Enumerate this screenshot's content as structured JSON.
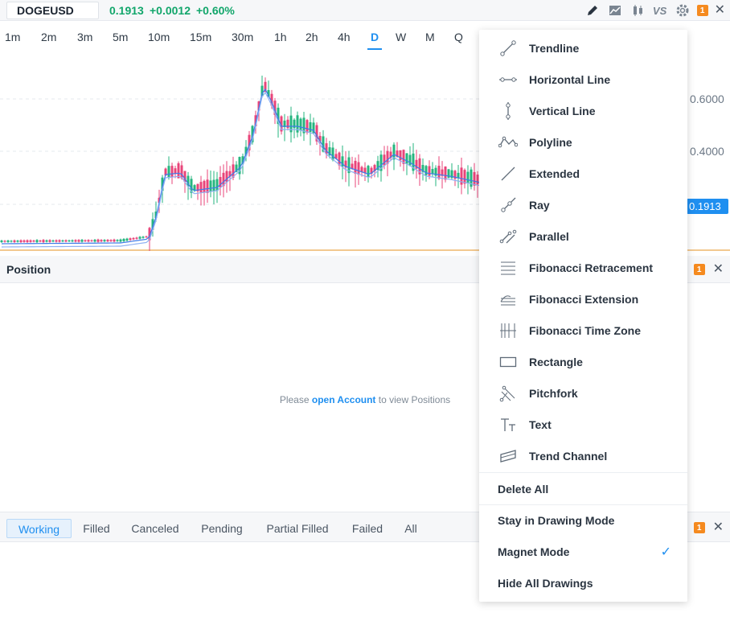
{
  "topbar": {
    "symbol": "DOGEUSD",
    "last": "0.1913",
    "change": "+0.0012",
    "change_pct": "+0.60%",
    "badge": "1"
  },
  "timeframes": [
    "1m",
    "2m",
    "3m",
    "5m",
    "10m",
    "15m",
    "30m",
    "1h",
    "2h",
    "4h",
    "D",
    "W",
    "M",
    "Q"
  ],
  "active_timeframe": "D",
  "chart": {
    "price_labels": [
      "0.6000",
      "0.4000"
    ],
    "last_price": "0.1913",
    "colors": {
      "up": "#26b57f",
      "down": "#e8447a",
      "ma": "#3d7be8",
      "last": "#1f8ff0"
    }
  },
  "position_panel": {
    "title": "Position",
    "badge": "1",
    "msg_pre": "Please",
    "msg_link": "open Account",
    "msg_post": "to view Positions"
  },
  "orders_panel": {
    "tabs": [
      "Working",
      "Filled",
      "Canceled",
      "Pending",
      "Partial Filled",
      "Failed",
      "All"
    ],
    "active_tab": "Working",
    "badge": "1"
  },
  "drawing_menu": {
    "tools": [
      {
        "label": "Trendline",
        "icon": "trendline-icon"
      },
      {
        "label": "Horizontal Line",
        "icon": "horizontal-line-icon"
      },
      {
        "label": "Vertical Line",
        "icon": "vertical-line-icon"
      },
      {
        "label": "Polyline",
        "icon": "polyline-icon"
      },
      {
        "label": "Extended",
        "icon": "extended-line-icon"
      },
      {
        "label": "Ray",
        "icon": "ray-icon"
      },
      {
        "label": "Parallel",
        "icon": "parallel-icon"
      },
      {
        "label": "Fibonacci Retracement",
        "icon": "fib-retracement-icon"
      },
      {
        "label": "Fibonacci Extension",
        "icon": "fib-extension-icon"
      },
      {
        "label": "Fibonacci Time Zone",
        "icon": "fib-time-zone-icon"
      },
      {
        "label": "Rectangle",
        "icon": "rectangle-icon"
      },
      {
        "label": "Pitchfork",
        "icon": "pitchfork-icon"
      },
      {
        "label": "Text",
        "icon": "text-icon"
      },
      {
        "label": "Trend Channel",
        "icon": "trend-channel-icon"
      }
    ],
    "delete_all": "Delete All",
    "stay_in_drawing_mode": "Stay in Drawing Mode",
    "magnet_mode": "Magnet Mode",
    "magnet_mode_checked": true,
    "hide_all_drawings": "Hide All Drawings"
  }
}
